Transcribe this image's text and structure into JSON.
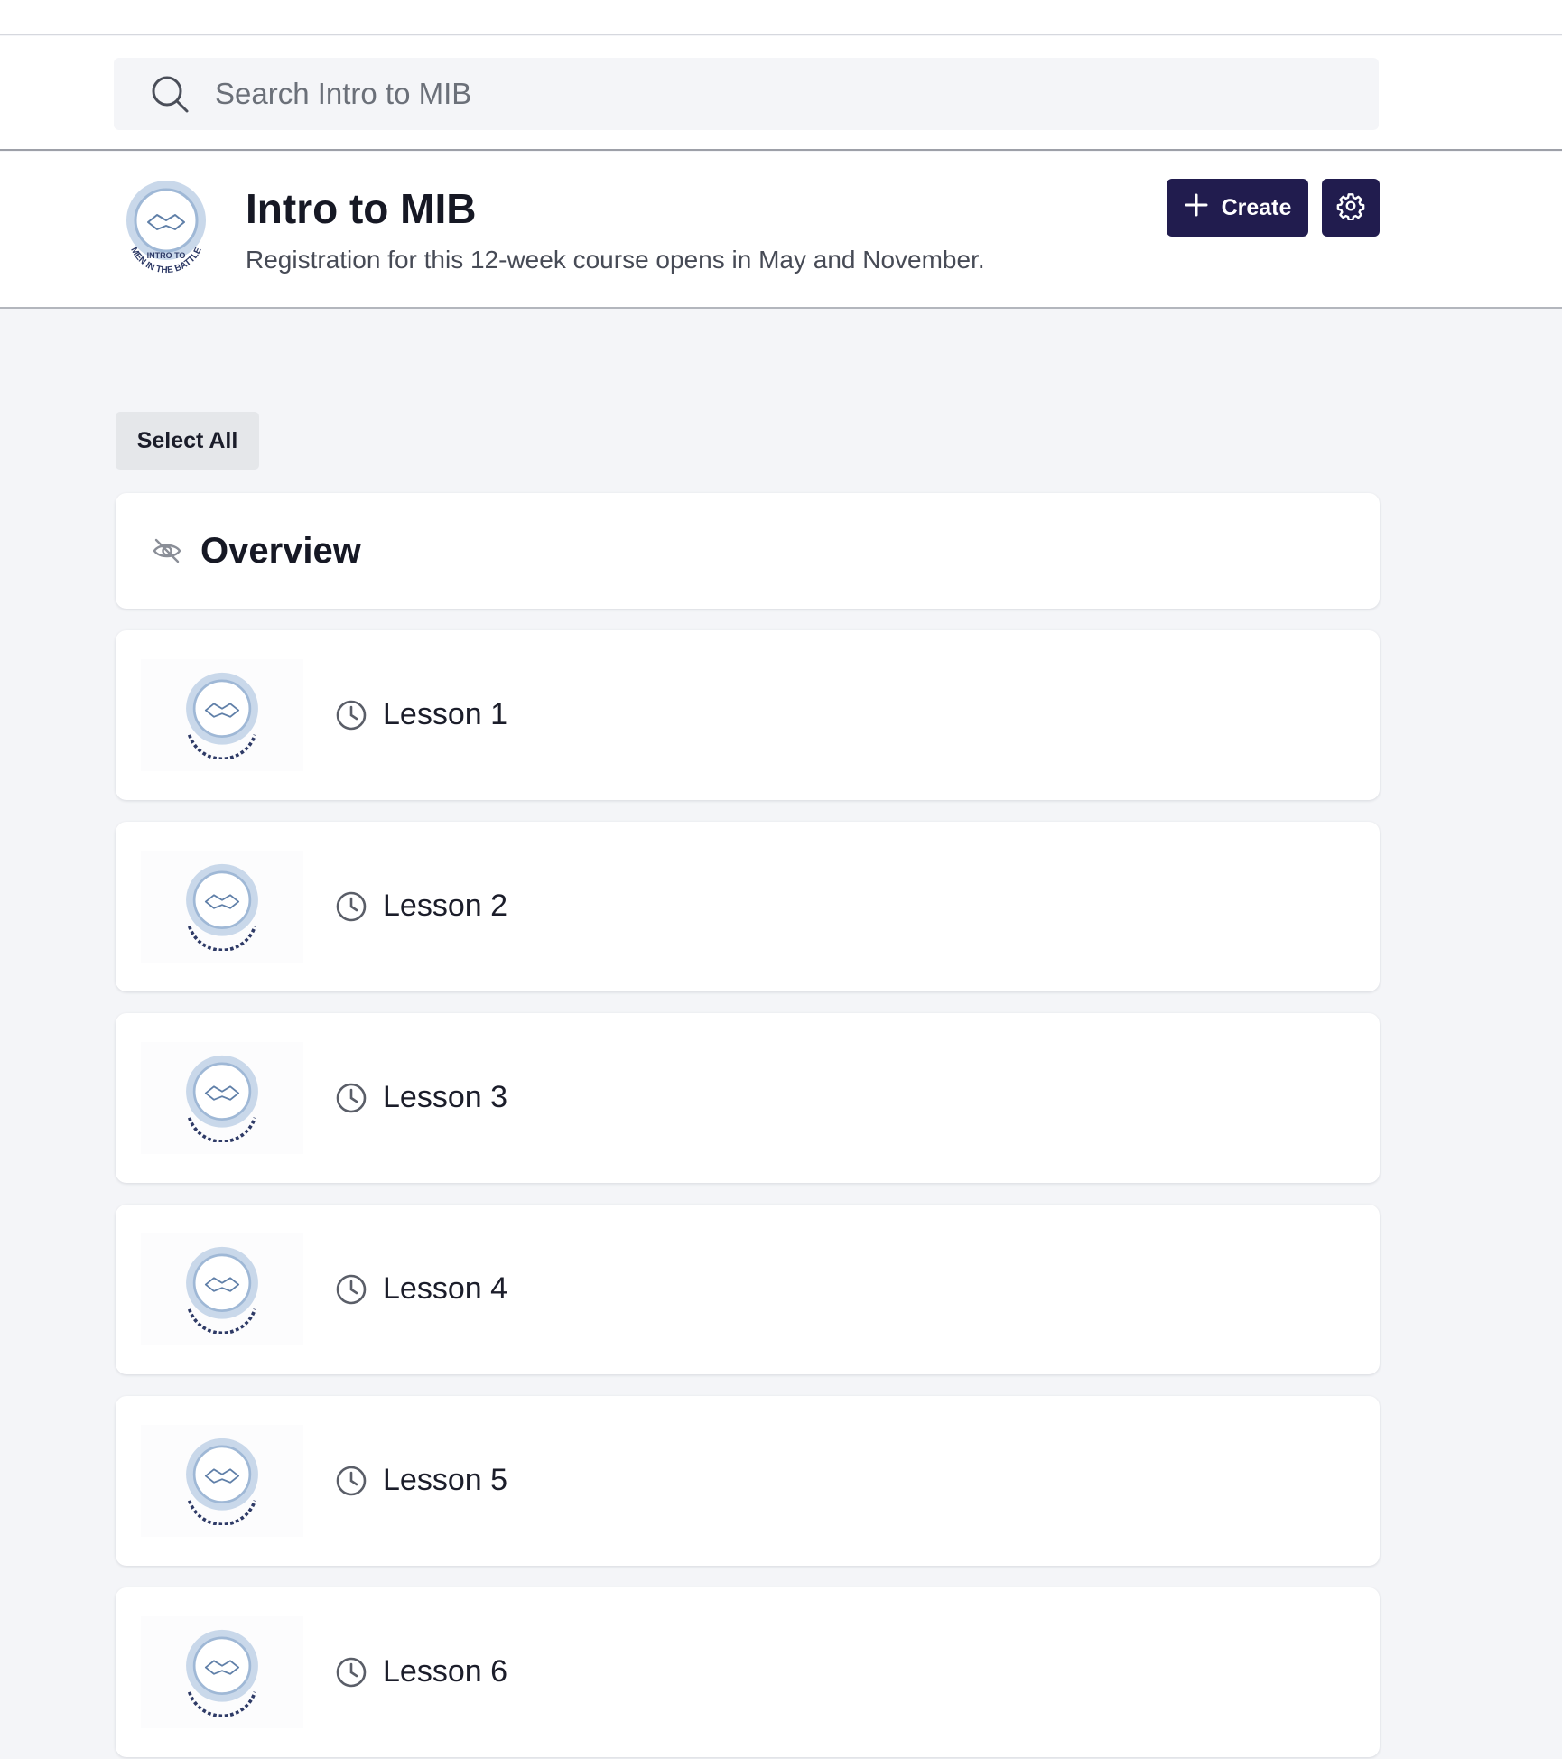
{
  "search": {
    "placeholder": "Search Intro to MIB",
    "value": ""
  },
  "course": {
    "title": "Intro to MIB",
    "description": "Registration for this 12-week course opens in May and November.",
    "logo": {
      "top_text": "INTRO TO",
      "bottom_text": "MEN IN THE BATTLE"
    }
  },
  "toolbar": {
    "create_label": "Create",
    "settings_icon": "gear-icon"
  },
  "list": {
    "select_all_label": "Select All",
    "overview_label": "Overview",
    "overview_icon": "eye-off-icon",
    "lessons": [
      {
        "title": "Lesson 1"
      },
      {
        "title": "Lesson 2"
      },
      {
        "title": "Lesson 3"
      },
      {
        "title": "Lesson 4"
      },
      {
        "title": "Lesson 5"
      },
      {
        "title": "Lesson 6"
      }
    ]
  },
  "colors": {
    "brand": "#211c4e",
    "page_background": "#f4f5f8",
    "logo_blue": "#a9c1dc"
  }
}
